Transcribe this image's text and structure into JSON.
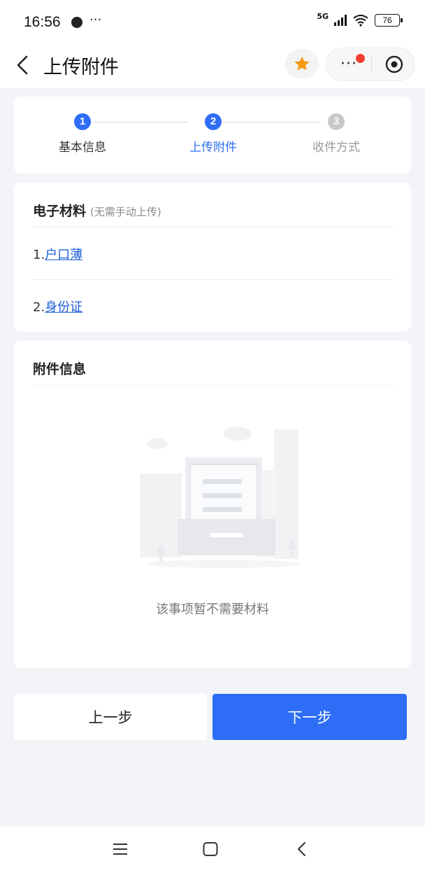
{
  "status_bar": {
    "time": "16:56",
    "more": "···",
    "network": "5G",
    "battery": "76"
  },
  "nav": {
    "title": "上传附件",
    "more": "···"
  },
  "steps": [
    {
      "number": "1",
      "label": "基本信息",
      "state": "done"
    },
    {
      "number": "2",
      "label": "上传附件",
      "state": "active"
    },
    {
      "number": "3",
      "label": "收件方式",
      "state": "pending"
    }
  ],
  "colors": {
    "accent": "#2e6df6",
    "link": "#1f5fd6",
    "favorite": "#f59a12",
    "badge": "#f2402f",
    "inactive": "#c8c8c8"
  },
  "materials": {
    "title": "电子材料",
    "subtitle": "(无需手动上传)",
    "items": [
      {
        "prefix": "1.",
        "name": "户口薄"
      },
      {
        "prefix": "2.",
        "name": "身份证"
      }
    ]
  },
  "attachments": {
    "title": "附件信息",
    "empty_text": "该事项暂不需要材料"
  },
  "buttons": {
    "prev": "上一步",
    "next": "下一步"
  },
  "icons": [
    "back-icon",
    "star-icon",
    "more-icon",
    "target-icon",
    "menu-icon",
    "home-icon",
    "back-nav-icon"
  ]
}
